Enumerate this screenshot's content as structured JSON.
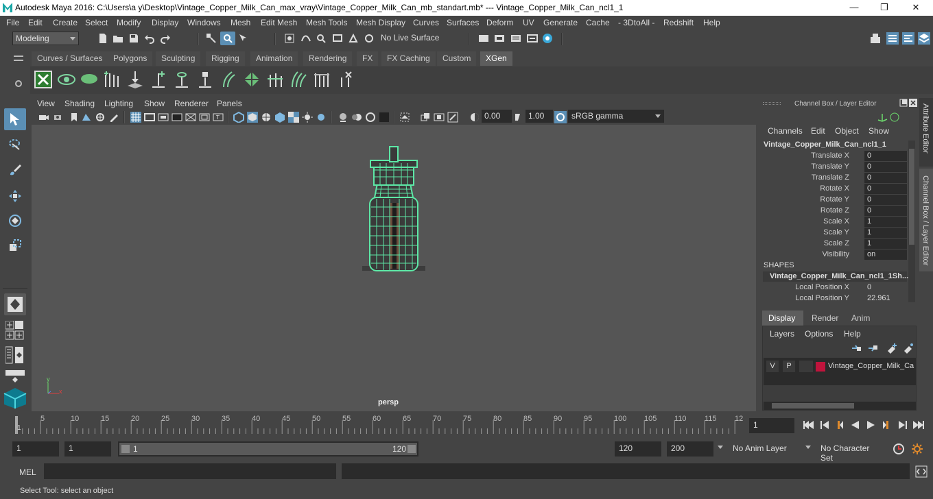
{
  "window": {
    "title": "Autodesk Maya 2016: C:\\Users\\a y\\Desktop\\Vintage_Copper_Milk_Can_max_vray\\Vintage_Copper_Milk_Can_mb_standart.mb*   ---   Vintage_Copper_Milk_Can_ncl1_1",
    "minimize": "—",
    "restore": "❐",
    "close": "✕"
  },
  "menubar": [
    "File",
    "Edit",
    "Create",
    "Select",
    "Modify",
    "Display",
    "Windows",
    "Mesh",
    "Edit Mesh",
    "Mesh Tools",
    "Mesh Display",
    "Curves",
    "Surfaces",
    "Deform",
    "UV",
    "Generate",
    "Cache",
    "- 3DtoAll -",
    "Redshift",
    "Help"
  ],
  "statusline": {
    "mode": "Modeling",
    "live_surface": "No Live Surface"
  },
  "shelf": {
    "tabs": [
      "Curves / Surfaces",
      "Polygons",
      "Sculpting",
      "Rigging",
      "Animation",
      "Rendering",
      "FX",
      "FX Caching",
      "Custom",
      "XGen"
    ],
    "active_tab": "XGen"
  },
  "viewport": {
    "menu": [
      "View",
      "Shading",
      "Lighting",
      "Show",
      "Renderer",
      "Panels"
    ],
    "exposure": "0.00",
    "gamma": "1.00",
    "color_space": "sRGB gamma",
    "camera": "persp",
    "axis_x": "x",
    "axis_y": "y"
  },
  "channelbox": {
    "header": "Channel Box / Layer Editor",
    "menu": [
      "Channels",
      "Edit",
      "Object",
      "Show"
    ],
    "object": "Vintage_Copper_Milk_Can_ncl1_1",
    "attributes": [
      {
        "label": "Translate X",
        "value": "0"
      },
      {
        "label": "Translate Y",
        "value": "0"
      },
      {
        "label": "Translate Z",
        "value": "0"
      },
      {
        "label": "Rotate X",
        "value": "0"
      },
      {
        "label": "Rotate Y",
        "value": "0"
      },
      {
        "label": "Rotate Z",
        "value": "0"
      },
      {
        "label": "Scale X",
        "value": "1"
      },
      {
        "label": "Scale Y",
        "value": "1"
      },
      {
        "label": "Scale Z",
        "value": "1"
      },
      {
        "label": "Visibility",
        "value": "on"
      }
    ],
    "shapes_header": "SHAPES",
    "shape_name": "Vintage_Copper_Milk_Can_ncl1_1Sh...",
    "shape_attrs": [
      {
        "label": "Local Position X",
        "value": "0"
      },
      {
        "label": "Local Position Y",
        "value": "22.961"
      }
    ],
    "side_tabs": [
      "Attribute Editor",
      "Channel Box / Layer Editor"
    ]
  },
  "layer_editor": {
    "tabs": [
      "Display",
      "Render",
      "Anim"
    ],
    "active_tab": "Display",
    "menu": [
      "Layers",
      "Options",
      "Help"
    ],
    "layer": {
      "v": "V",
      "p": "P",
      "name": "Vintage_Copper_Milk_Ca",
      "color": "#c0143c"
    }
  },
  "timeline": {
    "ticks": [
      "5",
      "10",
      "15",
      "20",
      "25",
      "30",
      "35",
      "40",
      "45",
      "50",
      "55",
      "60",
      "65",
      "70",
      "75",
      "80",
      "85",
      "90",
      "95",
      "100",
      "105",
      "110",
      "115",
      "12"
    ],
    "start_marker": "1",
    "current_frame": "1"
  },
  "range": {
    "start": "1",
    "playback_start": "1",
    "slider_start": "1",
    "slider_end": "120",
    "playback_end": "120",
    "end": "200",
    "anim_layer": "No Anim Layer",
    "character_set": "No Character Set"
  },
  "cmdline": {
    "label": "MEL"
  },
  "helpline": {
    "text": "Select Tool: select an object"
  },
  "colors": {
    "wireframe": "#5de8a6",
    "accent_teal": "#1aa6a6"
  }
}
